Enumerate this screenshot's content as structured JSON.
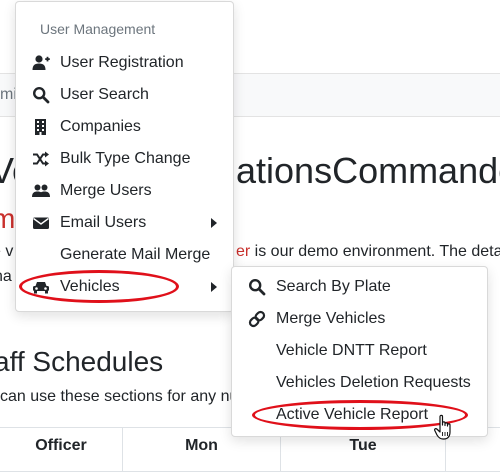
{
  "background": {
    "breadcrumb": "min",
    "title_left": "Ve",
    "title_right": "ationsCommander",
    "red_subtitle": "m",
    "demo_text_left": "e v",
    "demo_text_red": "er",
    "demo_text_right": " is our demo environment.  The deta",
    "demo_text_line2": "na",
    "section_title": "aff Schedules",
    "section_desc": "can use these sections for any nu",
    "schedule_headers": [
      "Officer",
      "Mon",
      "Tue",
      ""
    ]
  },
  "menu": {
    "header": "User Management",
    "items": [
      {
        "label": "User Registration",
        "icon": "user-plus-icon"
      },
      {
        "label": "User Search",
        "icon": "search-icon"
      },
      {
        "label": "Companies",
        "icon": "building-icon"
      },
      {
        "label": "Bulk Type Change",
        "icon": "shuffle-icon"
      },
      {
        "label": "Merge Users",
        "icon": "users-icon"
      },
      {
        "label": "Email Users",
        "icon": "envelope-icon"
      },
      {
        "label": "Generate Mail Merge",
        "icon": ""
      },
      {
        "label": "Vehicles",
        "icon": "car-icon"
      }
    ]
  },
  "submenu": {
    "items": [
      {
        "label": "Search By Plate",
        "icon": "search-icon"
      },
      {
        "label": "Merge Vehicles",
        "icon": "link-icon"
      },
      {
        "label": "Vehicle DNTT Report",
        "icon": ""
      },
      {
        "label": "Vehicles Deletion Requests",
        "icon": ""
      },
      {
        "label": "Active Vehicle Report",
        "icon": ""
      }
    ]
  },
  "colors": {
    "annotation": "#e0101a",
    "accent_red": "#c9302c",
    "muted": "#6c757d"
  }
}
